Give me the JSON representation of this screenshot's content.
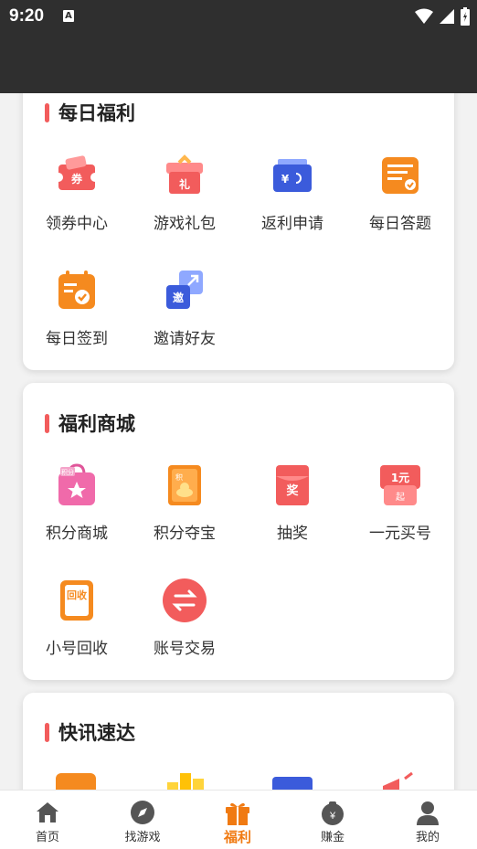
{
  "status": {
    "time": "9:20",
    "a_icon": "A"
  },
  "sections": [
    {
      "title": "每日福利",
      "items": [
        {
          "label": "领券中心",
          "icon": "coupon-icon",
          "glyph": "券"
        },
        {
          "label": "游戏礼包",
          "icon": "gift-pack-icon",
          "glyph": "礼"
        },
        {
          "label": "返利申请",
          "icon": "rebate-wallet-icon",
          "glyph": "¥"
        },
        {
          "label": "每日答题",
          "icon": "quiz-icon",
          "glyph": ""
        },
        {
          "label": "每日签到",
          "icon": "checkin-calendar-icon",
          "glyph": ""
        },
        {
          "label": "邀请好友",
          "icon": "invite-icon",
          "glyph": "邀"
        }
      ]
    },
    {
      "title": "福利商城",
      "items": [
        {
          "label": "积分商城",
          "icon": "points-shop-bag-icon",
          "glyph": "积分"
        },
        {
          "label": "积分夺宝",
          "icon": "points-treasure-icon",
          "glyph": "积"
        },
        {
          "label": "抽奖",
          "icon": "lottery-envelope-icon",
          "glyph": "奖"
        },
        {
          "label": "一元买号",
          "icon": "one-yuan-icon",
          "glyph": "1元",
          "glyph2": "起"
        },
        {
          "label": "小号回收",
          "icon": "recycle-icon",
          "glyph": "回收"
        },
        {
          "label": "账号交易",
          "icon": "exchange-icon",
          "glyph": ""
        }
      ]
    },
    {
      "title": "快讯速达",
      "items": []
    }
  ],
  "tabs": [
    {
      "label": "首页",
      "icon": "home-icon"
    },
    {
      "label": "找游戏",
      "icon": "compass-icon"
    },
    {
      "label": "福利",
      "icon": "gift-icon",
      "active": true
    },
    {
      "label": "赚金",
      "icon": "money-bag-icon"
    },
    {
      "label": "我的",
      "icon": "user-icon"
    }
  ],
  "colors": {
    "accent": "#f07a12",
    "title_bar": "#f25c5c",
    "statusbar": "#2f2f2f"
  }
}
